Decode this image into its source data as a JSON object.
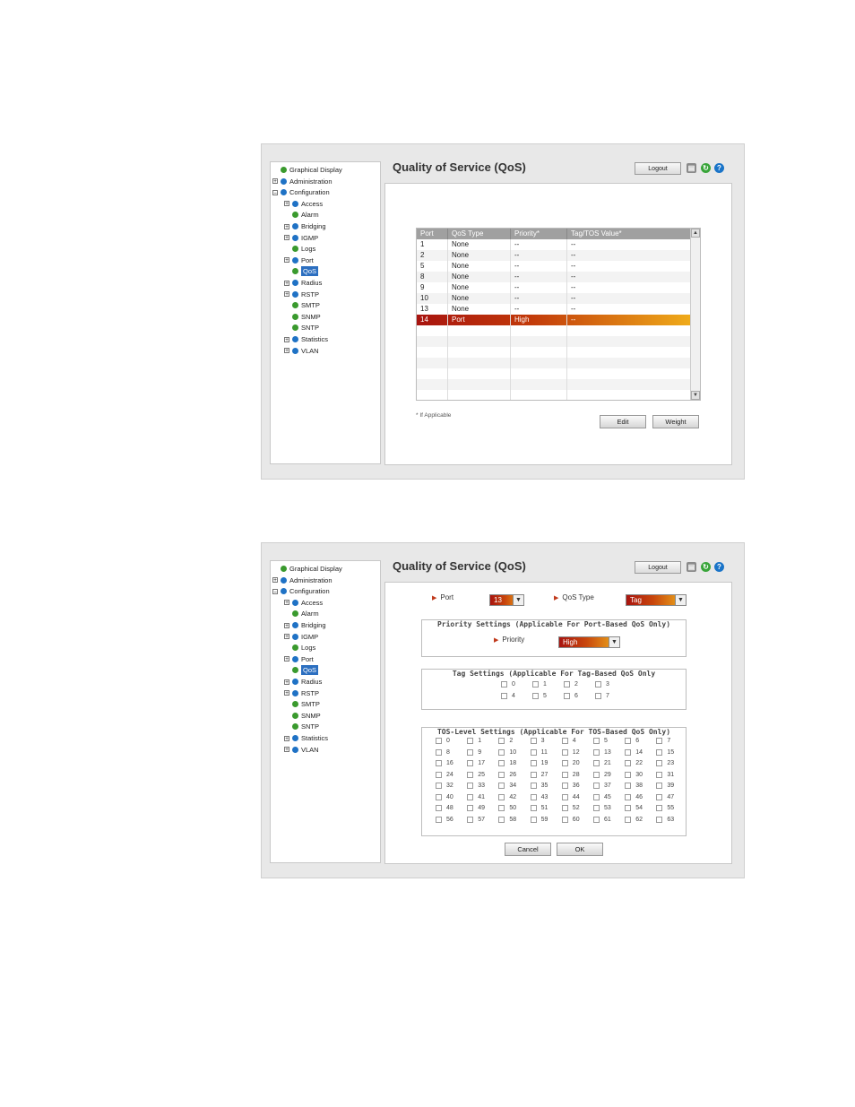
{
  "nav_tree": [
    {
      "label": "Graphical Display",
      "level": 0,
      "expander": "",
      "bullet": "green"
    },
    {
      "label": "Administration",
      "level": 0,
      "expander": "+",
      "bullet": "blue"
    },
    {
      "label": "Configuration",
      "level": 0,
      "expander": "−",
      "bullet": "blue"
    },
    {
      "label": "Access",
      "level": 1,
      "expander": "+",
      "bullet": "blue"
    },
    {
      "label": "Alarm",
      "level": 1,
      "expander": "",
      "bullet": "green"
    },
    {
      "label": "Bridging",
      "level": 1,
      "expander": "+",
      "bullet": "blue"
    },
    {
      "label": "IGMP",
      "level": 1,
      "expander": "+",
      "bullet": "blue"
    },
    {
      "label": "Logs",
      "level": 1,
      "expander": "",
      "bullet": "green"
    },
    {
      "label": "Port",
      "level": 1,
      "expander": "+",
      "bullet": "blue"
    },
    {
      "label": "QoS",
      "level": 1,
      "expander": "",
      "bullet": "green",
      "selected": true
    },
    {
      "label": "Radius",
      "level": 1,
      "expander": "+",
      "bullet": "blue"
    },
    {
      "label": "RSTP",
      "level": 1,
      "expander": "+",
      "bullet": "blue"
    },
    {
      "label": "SMTP",
      "level": 1,
      "expander": "",
      "bullet": "green"
    },
    {
      "label": "SNMP",
      "level": 1,
      "expander": "",
      "bullet": "green"
    },
    {
      "label": "SNTP",
      "level": 1,
      "expander": "",
      "bullet": "green"
    },
    {
      "label": "Statistics",
      "level": 1,
      "expander": "+",
      "bullet": "blue"
    },
    {
      "label": "VLAN",
      "level": 1,
      "expander": "+",
      "bullet": "blue"
    }
  ],
  "header": {
    "title": "Quality of Service (QoS)",
    "logout_label": "Logout",
    "icons": [
      "save-icon",
      "refresh-icon",
      "help-icon"
    ]
  },
  "qos_table": {
    "columns": [
      "Port",
      "QoS Type",
      "Priority*",
      "Tag/TOS Value*"
    ],
    "rows": [
      [
        "1",
        "None",
        "--",
        "--"
      ],
      [
        "2",
        "None",
        "--",
        "--"
      ],
      [
        "5",
        "None",
        "--",
        "--"
      ],
      [
        "8",
        "None",
        "--",
        "--"
      ],
      [
        "9",
        "None",
        "--",
        "--"
      ],
      [
        "10",
        "None",
        "--",
        "--"
      ],
      [
        "13",
        "None",
        "--",
        "--"
      ],
      [
        "14",
        "Port",
        "High",
        "--"
      ]
    ],
    "selected_row": 7,
    "footnote": "* If Applicable",
    "edit_label": "Edit",
    "weight_label": "Weight"
  },
  "qos_form": {
    "port_label": "Port",
    "port_value": "13",
    "qos_type_label": "QoS Type",
    "qos_type_value": "Tag",
    "priority_legend": "Priority Settings (Applicable For Port-Based QoS Only)",
    "priority_label": "Priority",
    "priority_value": "High",
    "tag_legend": "Tag Settings (Applicable For Tag-Based QoS Only",
    "tag_values": [
      "0",
      "1",
      "2",
      "3",
      "4",
      "5",
      "6",
      "7"
    ],
    "tos_legend": "TOS-Level Settings (Applicable For TOS-Based QoS Only)",
    "tos_values": [
      "0",
      "1",
      "2",
      "3",
      "4",
      "5",
      "6",
      "7",
      "8",
      "9",
      "10",
      "11",
      "12",
      "13",
      "14",
      "15",
      "16",
      "17",
      "18",
      "19",
      "20",
      "21",
      "22",
      "23",
      "24",
      "25",
      "26",
      "27",
      "28",
      "29",
      "30",
      "31",
      "32",
      "33",
      "34",
      "35",
      "36",
      "37",
      "38",
      "39",
      "40",
      "41",
      "42",
      "43",
      "44",
      "45",
      "46",
      "47",
      "48",
      "49",
      "50",
      "51",
      "52",
      "53",
      "54",
      "55",
      "56",
      "57",
      "58",
      "59",
      "60",
      "61",
      "62",
      "63"
    ],
    "cancel_label": "Cancel",
    "ok_label": "OK"
  },
  "colors": {
    "selection_gradient_start": "#a8140f",
    "selection_gradient_end": "#f2b21b",
    "tree_selected": "#2c6fc0"
  }
}
